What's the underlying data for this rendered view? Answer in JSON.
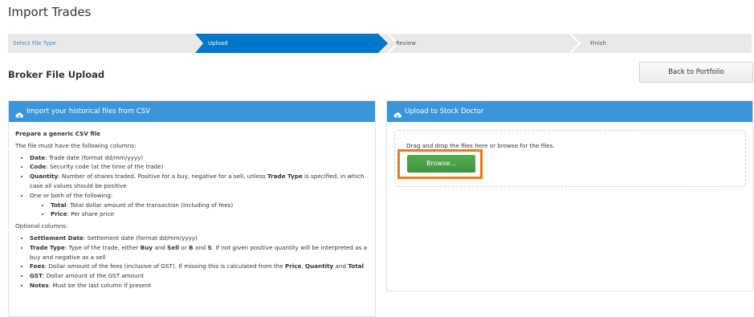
{
  "page": {
    "title": "Import Trades",
    "subtitle": "Broker File Upload"
  },
  "wizard": {
    "steps": [
      {
        "label": "Select File Type",
        "state": "completed"
      },
      {
        "label": "Upload",
        "state": "active"
      },
      {
        "label": "Review",
        "state": "pending"
      },
      {
        "label": "Finish",
        "state": "pending"
      }
    ]
  },
  "actions": {
    "back_label": "Back to Portfolio"
  },
  "left_panel": {
    "heading": "Import your historical files from CSV",
    "prepare_title": "Prepare a generic CSV file",
    "intro": "The file must have the following columns:",
    "required": {
      "date_label": "Date",
      "date_desc": ": Trade date (format dd/mm/yyyy)",
      "code_label": "Code",
      "code_desc": ": Security code (at the time of the trade)",
      "qty_label": "Quantity",
      "qty_desc_1": ": Number of shares traded. Positive for a buy, negative for a sell, unless ",
      "qty_trade_type": "Trade Type",
      "qty_desc_2": " is specified, in which case all values should be positive",
      "one_or_both": "One or both of the following:",
      "total_label": "Total",
      "total_desc": ": Total dollar amount of the transaction (including of fees)",
      "price_label": "Price",
      "price_desc": ": Per share price"
    },
    "optional_title": "Optional columns:",
    "optional": {
      "settle_label": "Settlement Date",
      "settle_desc": ": Settlement date (format dd/mm/yyyy)",
      "tt_label": "Trade Type",
      "tt_desc_1": ": Type of the trade, either ",
      "tt_buy": "Buy",
      "tt_and": " and ",
      "tt_sell": "Sell",
      "tt_or": " or ",
      "tt_b": "B",
      "tt_and2": " and ",
      "tt_s": "S",
      "tt_desc_2": ". If not given positive quantity will be interpreted as a buy and negative as a sell",
      "fees_label": "Fees",
      "fees_desc_1": ": Dollar amount of the fees (inclusive of GST). If missing this is calculated from the ",
      "fees_price": "Price",
      "fees_comma": ", ",
      "fees_qty": "Quantity",
      "fees_and": " and ",
      "fees_total": "Total",
      "gst_label": "GST",
      "gst_desc": ": Dollar amount of the GST amount",
      "notes_label": "Notes",
      "notes_desc": ": Must be the last column if present"
    }
  },
  "right_panel": {
    "heading": "Upload to Stock Doctor",
    "drop_text": "Drag and drop the files here or browse for the files.",
    "browse_label": "Browse..."
  },
  "colors": {
    "header_blue": "#3b95d8",
    "active_step": "#0077c8",
    "browse_green": "#4a9f48",
    "highlight_orange": "#f07a1a"
  },
  "icons": {
    "panel_header_icon": "cloud-upload-icon"
  }
}
